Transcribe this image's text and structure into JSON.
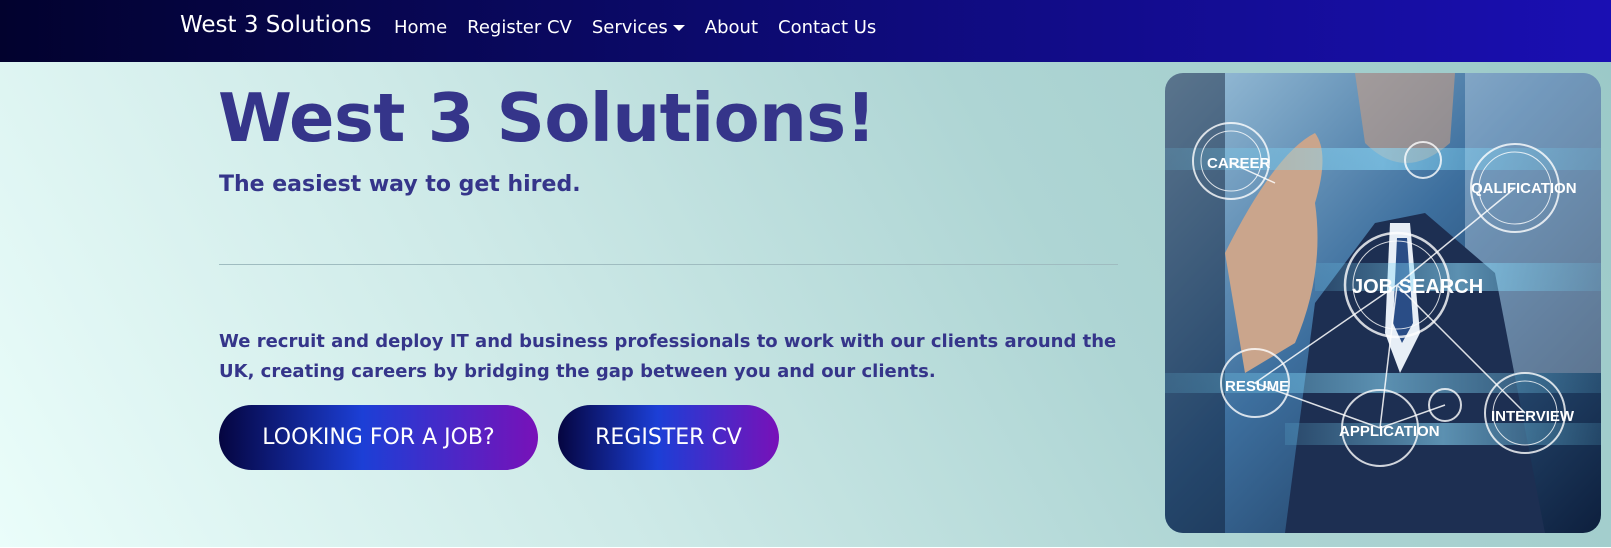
{
  "navbar": {
    "brand": "West 3 Solutions",
    "links": [
      {
        "label": "Home"
      },
      {
        "label": "Register CV"
      },
      {
        "label": "Services"
      },
      {
        "label": "About"
      },
      {
        "label": "Contact Us"
      }
    ]
  },
  "hero": {
    "title": "West 3 Solutions!",
    "subtitle": "The easiest way to get hired.",
    "description": "We recruit and deploy IT and business professionals to work with our clients around the UK, creating careers by bridging the gap between you and our clients.",
    "buttons": {
      "job": "LOOKING FOR A JOB?",
      "register": "REGISTER CV"
    }
  },
  "image": {
    "labels": {
      "career": "CAREER",
      "qualification": "QALIFICATION",
      "job_search": "JOB SEARCH",
      "resume": "RESUME",
      "application": "APPLICATION",
      "interview": "INTERVIEW"
    }
  },
  "colors": {
    "heading": "#35358a",
    "navbar_start": "#02022e",
    "navbar_end": "#1a0fb3",
    "button_start": "#050540",
    "button_mid": "#1c3fd6",
    "button_end": "#7811b8"
  }
}
